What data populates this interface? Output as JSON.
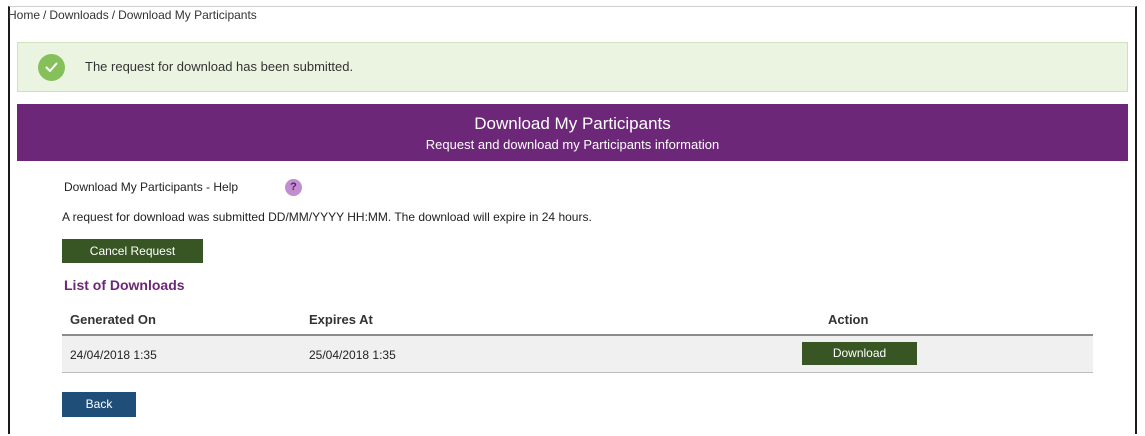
{
  "breadcrumb": {
    "items": [
      "Home",
      "Downloads",
      "Download My Participants"
    ],
    "separator": "/"
  },
  "alert": {
    "icon": "check-circle-icon",
    "message": "The request for download has been submitted.",
    "color": "#86c05a",
    "background": "#eaf4e1"
  },
  "banner": {
    "title": "Download My Participants",
    "subtitle": "Request and download my Participants information",
    "color": "#6c2778"
  },
  "help": {
    "label": "Download My Participants - Help",
    "icon": "help-icon",
    "icon_glyph": "?"
  },
  "info": {
    "text": "A request for download was submitted DD/MM/YYYY HH:MM. The download will expire in 24 hours."
  },
  "actions": {
    "cancel_label": "Cancel Request",
    "back_label": "Back"
  },
  "downloads": {
    "title": "List of Downloads",
    "columns": [
      "Generated On",
      "Expires At",
      "Action"
    ],
    "rows": [
      {
        "generated_on": "24/04/2018 1:35",
        "expires_at": "25/04/2018 1:35",
        "action_label": "Download"
      }
    ]
  },
  "colors": {
    "primary_green": "#375623",
    "primary_blue": "#1f4e79",
    "accent_purple": "#6c2778"
  }
}
